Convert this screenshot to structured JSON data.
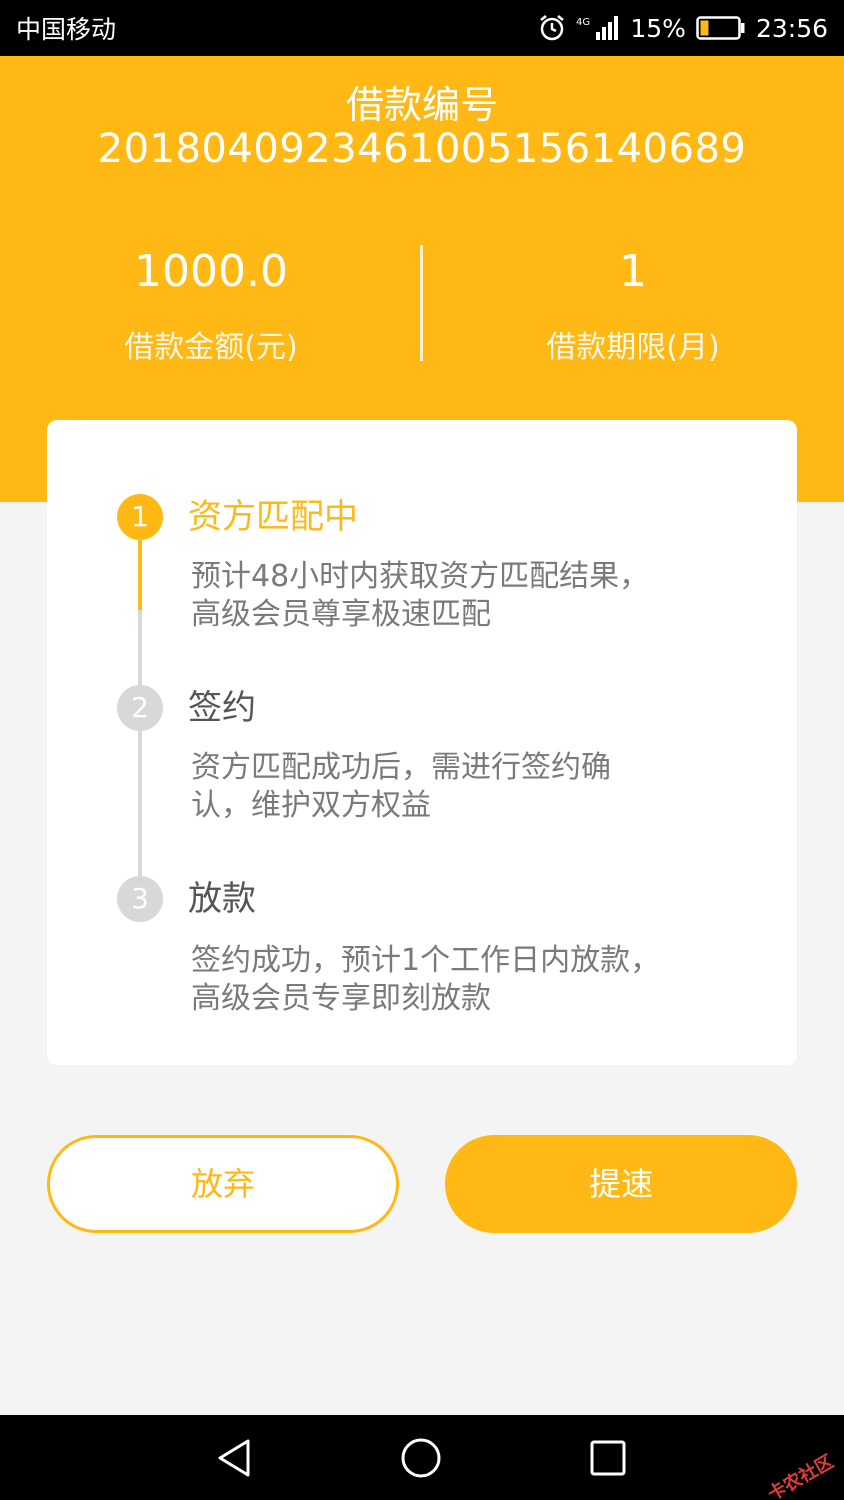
{
  "status_bar": {
    "carrier": "中国移动",
    "network": "4G",
    "battery": "15%",
    "time": "23:56"
  },
  "header": {
    "loan_number_label": "借款编号",
    "loan_number": "2018040923461005156140689",
    "amount_value": "1000.0",
    "amount_label": "借款金额(元)",
    "term_value": "1",
    "term_label": "借款期限(月)"
  },
  "steps": [
    {
      "number": "1",
      "title": "资方匹配中",
      "desc_line1": "预计48小时内获取资方匹配结果，",
      "desc_line2": "高级会员尊享极速匹配",
      "active": true
    },
    {
      "number": "2",
      "title": "签约",
      "desc_line1": "资方匹配成功后，需进行签约确",
      "desc_line2": "认，维护双方权益",
      "active": false
    },
    {
      "number": "3",
      "title": "放款",
      "desc_line1": "签约成功，预计1个工作日内放款，",
      "desc_line2": "高级会员专享即刻放款",
      "active": false
    }
  ],
  "buttons": {
    "abandon": "放弃",
    "speed_up": "提速"
  },
  "watermark": "卡农社区",
  "colors": {
    "accent": "#ffb814",
    "inactive": "#d8d8d8",
    "background": "#f4f4f4"
  }
}
